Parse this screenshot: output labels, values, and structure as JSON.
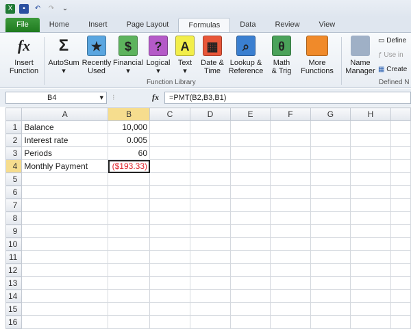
{
  "quick_access": {
    "icons": [
      "excel-icon",
      "save-icon",
      "undo-icon",
      "redo-icon",
      "customize-icon"
    ]
  },
  "tabs": [
    "File",
    "Home",
    "Insert",
    "Page Layout",
    "Formulas",
    "Data",
    "Review",
    "View"
  ],
  "active_tab": "Formulas",
  "ribbon": {
    "insert_function": [
      "Insert",
      "Function"
    ],
    "autosum": "AutoSum",
    "recently_used": [
      "Recently",
      "Used"
    ],
    "financial": "Financial",
    "logical": "Logical",
    "text": "Text",
    "date_time": [
      "Date &",
      "Time"
    ],
    "lookup": [
      "Lookup &",
      "Reference"
    ],
    "math": [
      "Math",
      "& Trig"
    ],
    "more": [
      "More",
      "Functions"
    ],
    "function_library_label": "Function Library",
    "name_manager": [
      "Name",
      "Manager"
    ],
    "define_name": "Define",
    "use_in": "Use in",
    "create": "Create",
    "defined_names_label": "Defined N"
  },
  "formula_bar": {
    "name_box": "B4",
    "fx": "fx",
    "formula": "=PMT(B2,B3,B1)"
  },
  "columns": [
    "A",
    "B",
    "C",
    "D",
    "E",
    "F",
    "G",
    "H"
  ],
  "rows": [
    {
      "n": "1",
      "a": "Balance",
      "b": "10,000"
    },
    {
      "n": "2",
      "a": "Interest rate",
      "b": "0.005"
    },
    {
      "n": "3",
      "a": "Periods",
      "b": "60"
    },
    {
      "n": "4",
      "a": "Monthly Payment",
      "b": "($193.33)"
    },
    {
      "n": "5"
    },
    {
      "n": "6"
    },
    {
      "n": "7"
    },
    {
      "n": "8"
    },
    {
      "n": "9"
    },
    {
      "n": "10"
    },
    {
      "n": "11"
    },
    {
      "n": "12"
    },
    {
      "n": "13"
    },
    {
      "n": "14"
    },
    {
      "n": "15"
    },
    {
      "n": "16"
    }
  ],
  "colors": {
    "file_tab": "#2a8a2a",
    "negative": "#e0222a"
  }
}
